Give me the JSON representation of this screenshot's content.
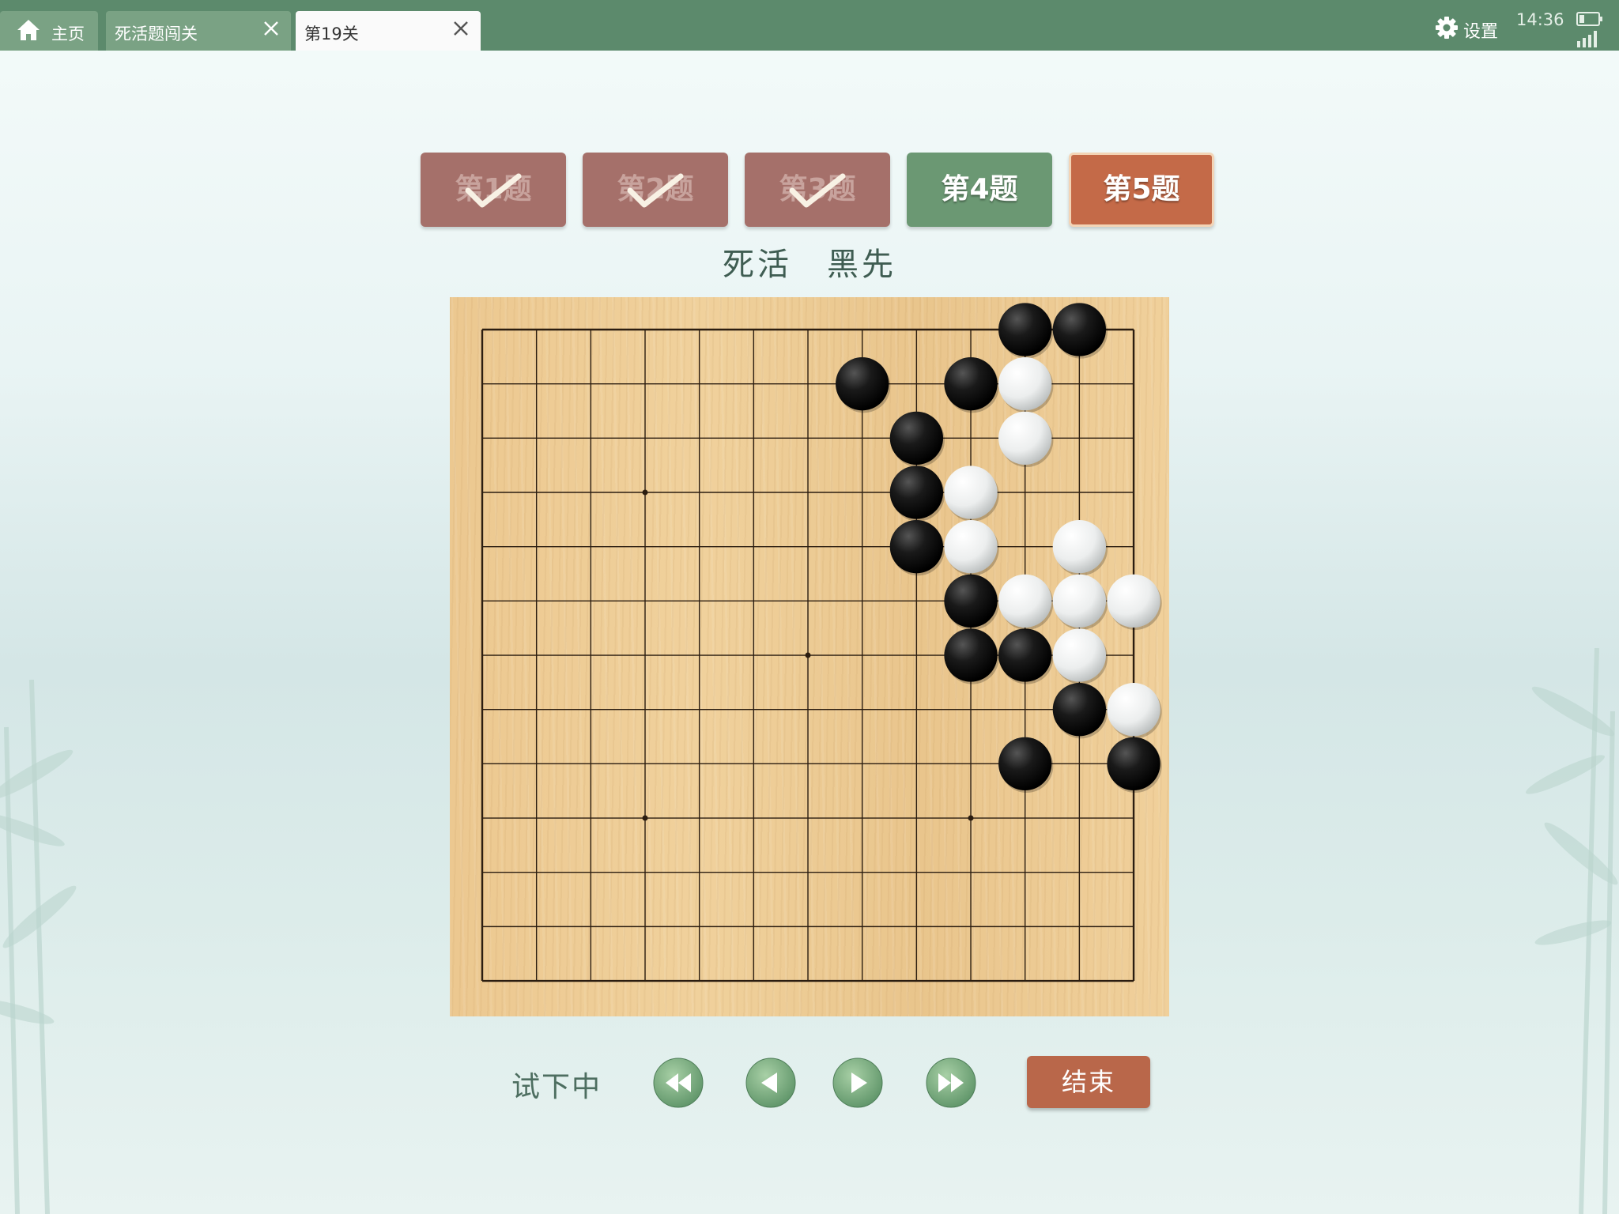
{
  "tabs": [
    {
      "label": "主页",
      "icon": "home-icon",
      "active": false,
      "closable": false
    },
    {
      "label": "死活题闯关",
      "active": false,
      "closable": true
    },
    {
      "label": "第19关",
      "active": true,
      "closable": true
    }
  ],
  "topbar": {
    "settings_label": "设置",
    "time": "14:36"
  },
  "problems": [
    {
      "label": "第1题",
      "state": "done"
    },
    {
      "label": "第2题",
      "state": "done"
    },
    {
      "label": "第3题",
      "state": "done"
    },
    {
      "label": "第4题",
      "state": "current"
    },
    {
      "label": "第5题",
      "state": "next"
    }
  ],
  "problem_type": "死活　黑先",
  "board": {
    "lines": 13,
    "star_points": [
      [
        3,
        3
      ],
      [
        3,
        9
      ],
      [
        6,
        6
      ],
      [
        9,
        3
      ],
      [
        9,
        9
      ]
    ],
    "black": [
      [
        0,
        10
      ],
      [
        0,
        11
      ],
      [
        1,
        7
      ],
      [
        1,
        9
      ],
      [
        2,
        8
      ],
      [
        3,
        8
      ],
      [
        4,
        8
      ],
      [
        5,
        9
      ],
      [
        6,
        9
      ],
      [
        6,
        10
      ],
      [
        7,
        11
      ],
      [
        8,
        10
      ],
      [
        8,
        12
      ]
    ],
    "white": [
      [
        1,
        10
      ],
      [
        2,
        10
      ],
      [
        3,
        9
      ],
      [
        4,
        9
      ],
      [
        4,
        11
      ],
      [
        5,
        10
      ],
      [
        5,
        11
      ],
      [
        5,
        12
      ],
      [
        6,
        11
      ],
      [
        7,
        12
      ]
    ]
  },
  "controls": {
    "status": "试下中",
    "end_label": "结束"
  },
  "colors": {
    "topbar": "#5c8a6c",
    "done": "#a5706a",
    "current": "#6b9873",
    "next": "#c46a48",
    "end": "#b9674a"
  }
}
